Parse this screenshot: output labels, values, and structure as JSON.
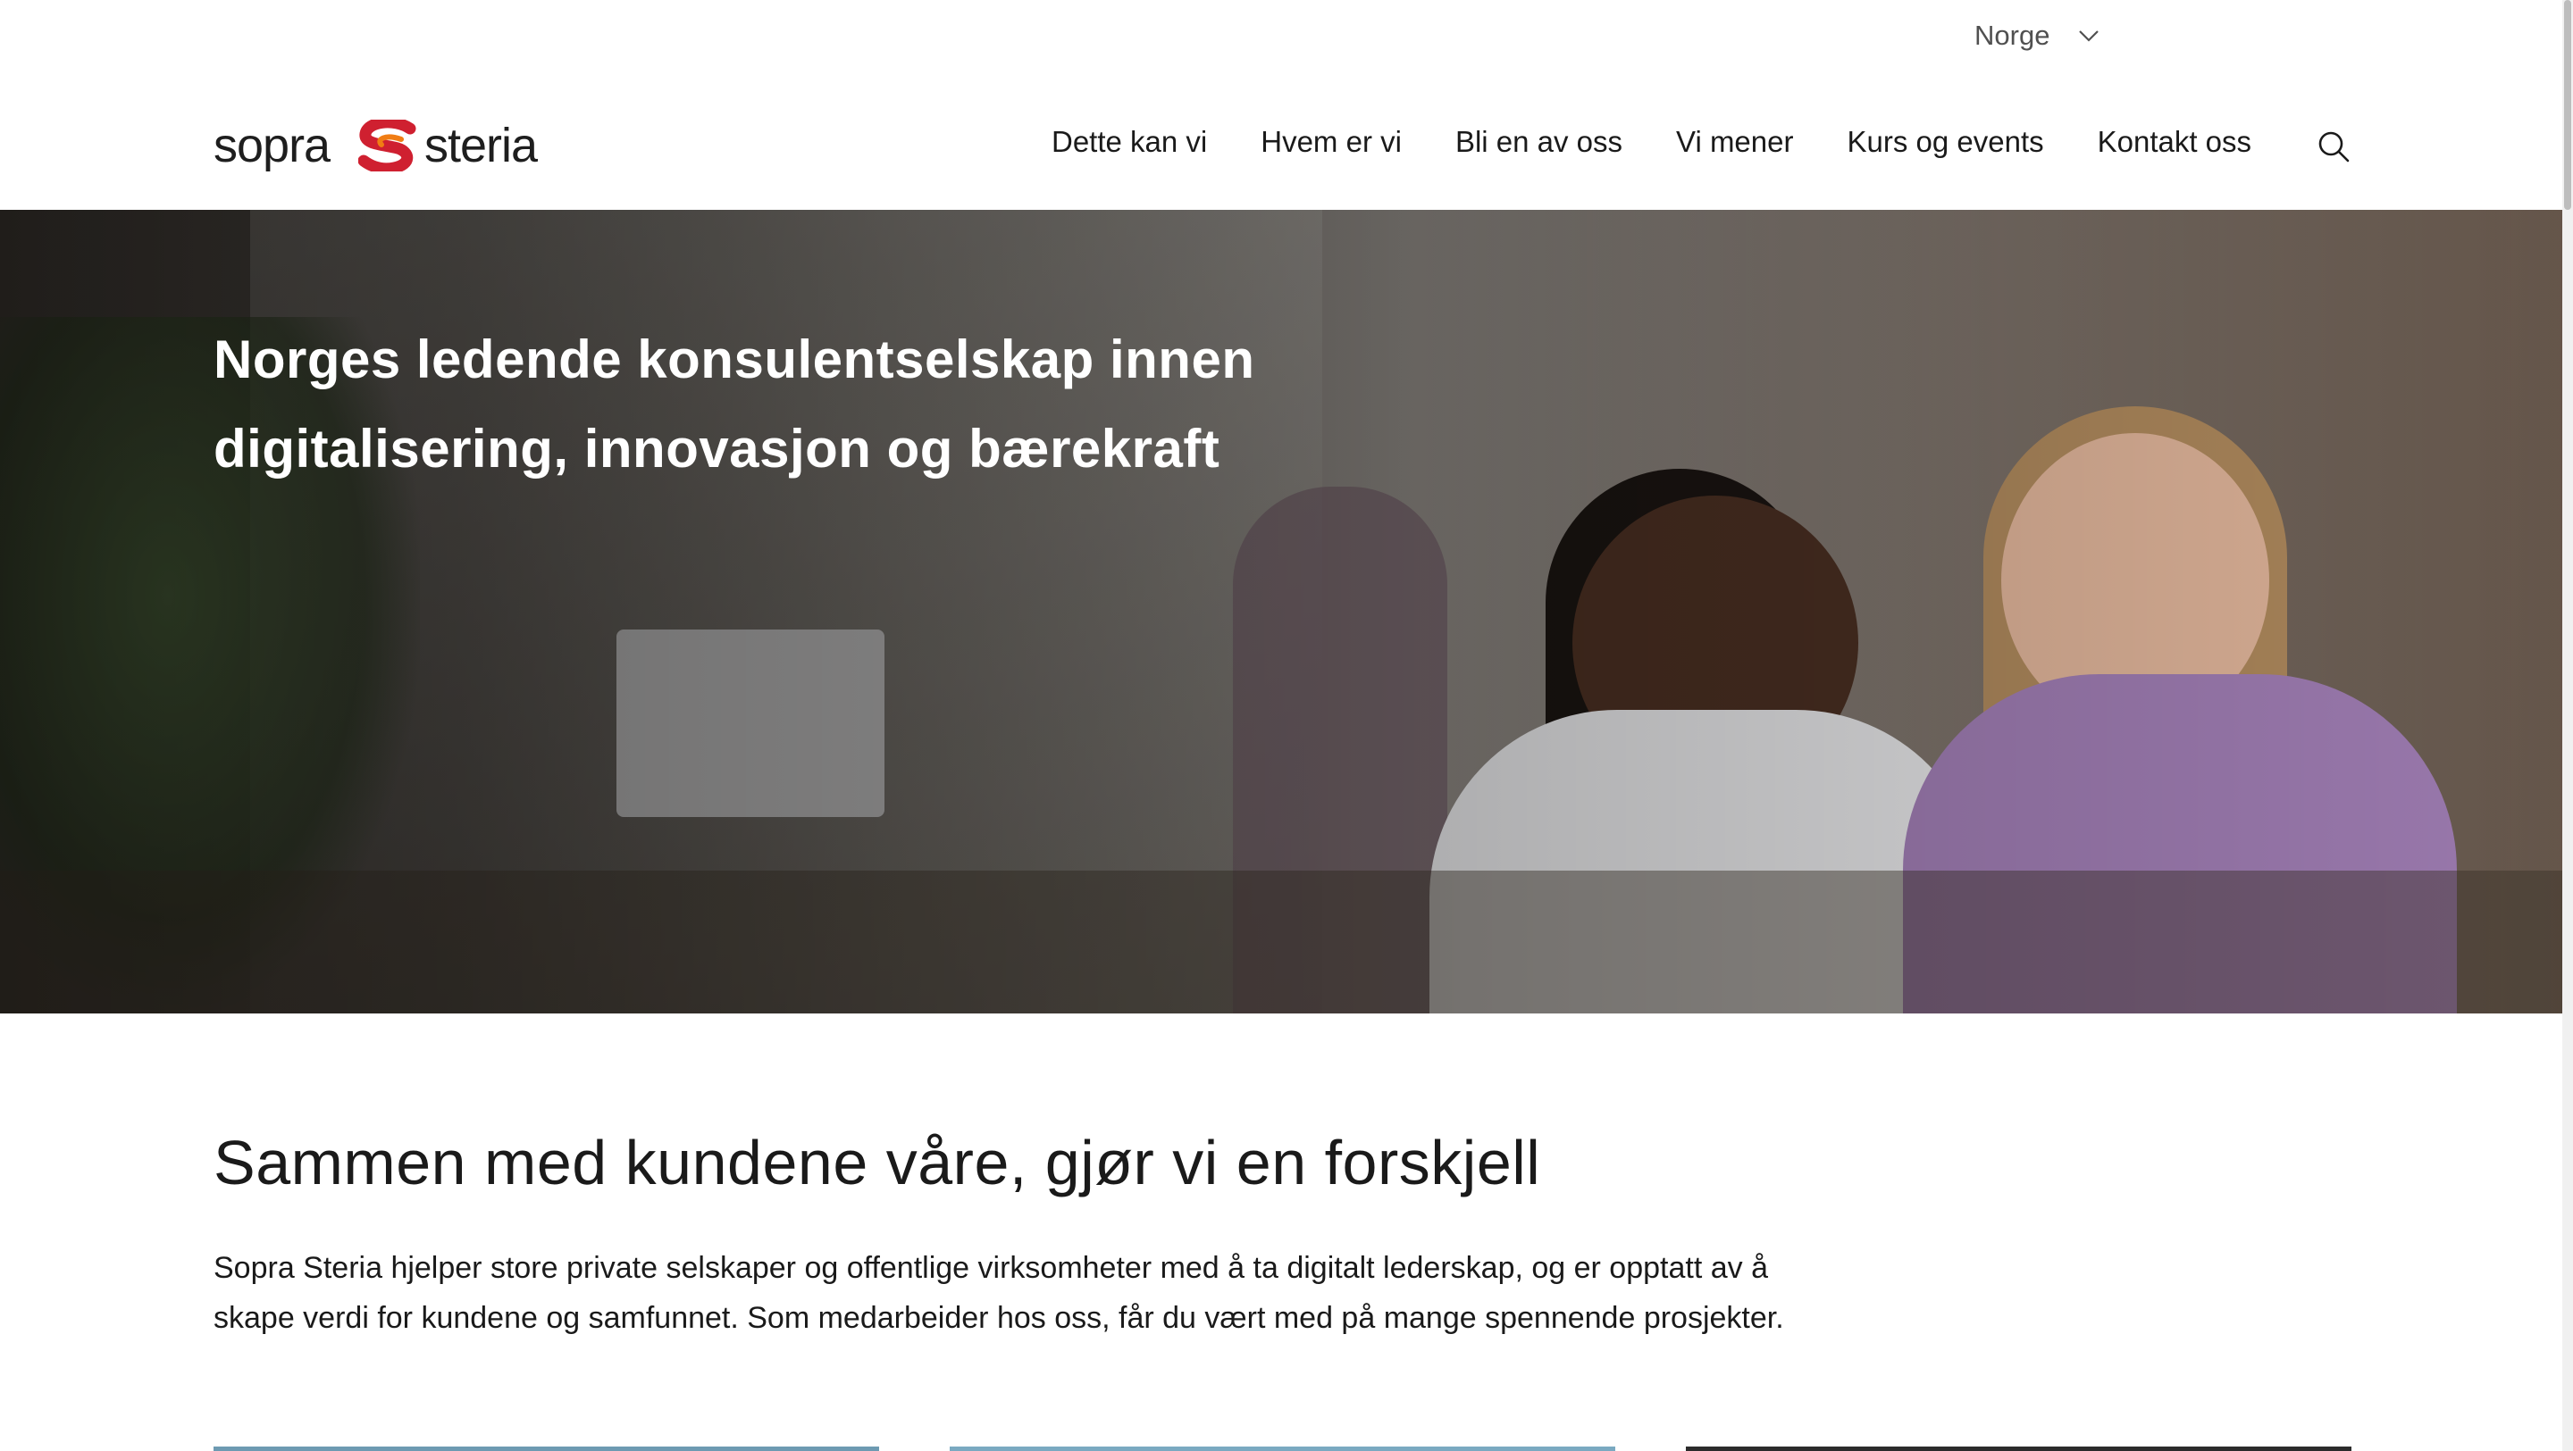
{
  "header": {
    "country_selector": "Norge",
    "logo": {
      "part1": "sopra",
      "part2": "steria",
      "mark_colors": [
        "#cf2030",
        "#f07d14"
      ]
    },
    "nav": [
      "Dette kan vi",
      "Hvem er vi",
      "Bli en av oss",
      "Vi mener",
      "Kurs og events",
      "Kontakt oss"
    ],
    "search_icon": "search-icon"
  },
  "hero": {
    "title": "Norges ledende konsulentselskap innen digitalisering, innovasjon og bærekraft"
  },
  "intro": {
    "title": "Sammen med kundene våre, gjør vi en forskjell",
    "body": "Sopra Steria hjelper store private selskaper og offentlige virksomheter med å ta digitalt lederskap, og er opptatt av å skape verdi for kundene og samfunnet. Som medarbeider hos oss, får du vært med på mange spennende prosjekter."
  }
}
